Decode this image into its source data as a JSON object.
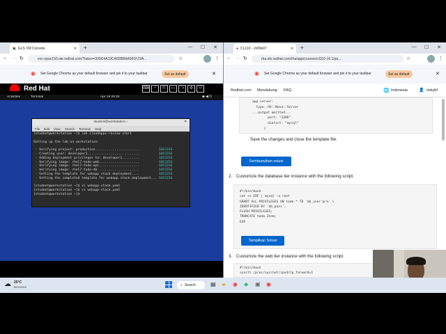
{
  "left_window": {
    "tab_title": "GLS VM Console",
    "url": "vnc-opac150.ole.redhat.com/?token=339C4A19CA82BBAA991F23A...",
    "banner_text": "Set Google Chrome as your default browser and pin it to your taskbar",
    "banner_button": "Set as default",
    "redhat_logo": "Red Hat",
    "gnome_activities": "Activities",
    "gnome_terminal": "Terminal",
    "gnome_clock": "Apr 19 09:33",
    "terminal_title": "student@workstation:~",
    "terminal_menu": [
      "File",
      "Edit",
      "View",
      "Search",
      "Terminal",
      "Help"
    ],
    "terminal_lines": [
      {
        "text": "[student@workstation ~]$ lab cloudapps-review start",
        "status": ""
      },
      {
        "text": "",
        "status": ""
      },
      {
        "text": "Setting up the lab on workstation:",
        "status": ""
      },
      {
        "text": "",
        "status": ""
      },
      {
        "text": " · Verifying project: production.......................",
        "status": "SUCCESS"
      },
      {
        "text": " · Creating user: developer1...........................",
        "status": "SUCCESS"
      },
      {
        "text": " · Adding deployment privileges to: developer1.........",
        "status": "SUCCESS"
      },
      {
        "text": " · Verifying image: rhel7-todo-web.....................",
        "status": "SUCCESS"
      },
      {
        "text": " · Verifying image: rhel7-todo-api.....................",
        "status": "SUCCESS"
      },
      {
        "text": " · Verifying image: rhel7-todo-db......................",
        "status": "SUCCESS"
      },
      {
        "text": " · Getting the template for webapp stack deployment....",
        "status": "SUCCESS"
      },
      {
        "text": " · Setting the completed template for webapp stack deployment...",
        "status": "SUCCESS"
      },
      {
        "text": "",
        "status": ""
      },
      {
        "text": "[student@workstation ~]$ vi webapp-stack.yaml",
        "status": ""
      },
      {
        "text": "[student@workstation ~]$ vi webapp-stack.yaml",
        "status": ""
      },
      {
        "text": "[student@workstation ~]$ ",
        "status": ""
      }
    ]
  },
  "right_window": {
    "tab_title": "CL110 - ch09s07",
    "url": "rha.ole.redhat.com/rha/app/courses/cl110-16.1/pa...",
    "banner_text": "Set Google Chrome as your default browser and pin it to your taskbar",
    "banner_button": "Set as default",
    "nav": [
      "Redhat.com",
      "Mendukung",
      "FAQ"
    ],
    "language": "Indonesia",
    "user": "riskybf",
    "yaml_lines": [
      "app_server:",
      "  type: OS::Nova::Server",
      "...output omitted...",
      "        port: \"3306\"",
      "        dialect: \"mysql\"",
      "      }"
    ],
    "save_text": "Save the changes and close the template file.",
    "hide_button": "Sembunyikan solusi",
    "step2_number": "2.",
    "step2_text": "Customize the database tier instance with the following script.",
    "db_script": [
      "#!/bin/bash",
      "cat << EOF | mysql -u root",
      "GRANT ALL PRIVILEGES ON todo.* TO 'db_user'@'%' \\",
      "IDENTIFIED BY 'db_pass';",
      "FLUSH PRIVILEGES;",
      "TRUNCATE todo.Item;",
      "EOF"
    ],
    "show_button": "Tampilkan Solusi",
    "step3_number": "3.",
    "step3_text": "Customize the web tier instance with the following script.",
    "web_script": [
      "#!/bin/bash",
      "sysctl /proc/sys/net/ipv4/ip_forward=1"
    ]
  },
  "taskbar": {
    "weather_temp": "25°C",
    "weather_desc": "Berawan",
    "search_label": "Search"
  }
}
